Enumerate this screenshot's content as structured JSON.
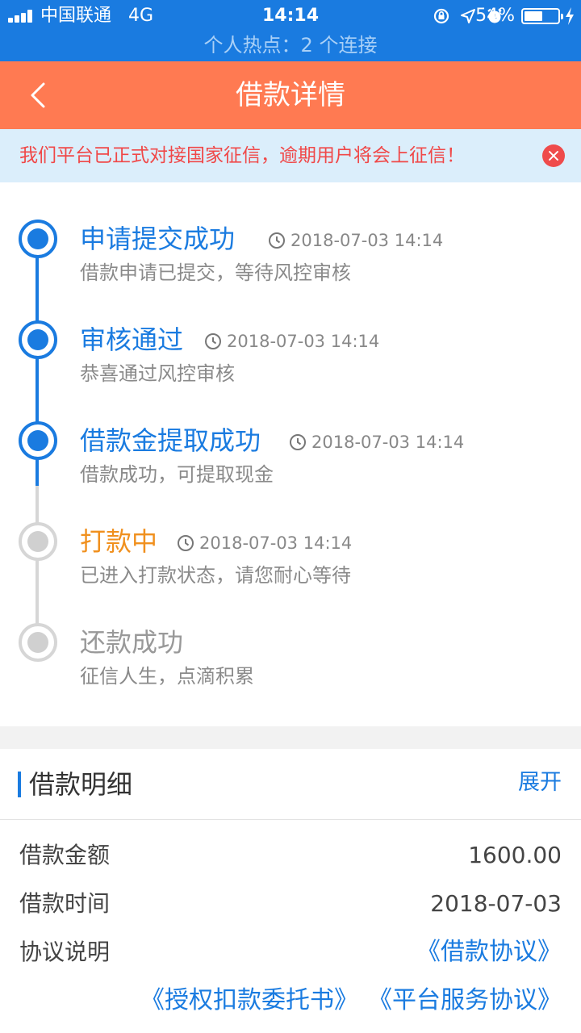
{
  "status_bar": {
    "carrier": "中国联通",
    "network": "4G",
    "time": "14:14",
    "battery": "54%",
    "battery_level": 0.54,
    "hotspot": "个人热点：2 个连接"
  },
  "header": {
    "title": "借款详情",
    "back_icon": "chevron-left-icon"
  },
  "notice": {
    "text": "我们平台已正式对接国家征信，逾期用户将会上征信！"
  },
  "timeline": {
    "steps": [
      {
        "title": "申请提交成功",
        "time": "2018-07-03 14:14",
        "desc": "借款申请已提交，等待风控审核",
        "state": "done"
      },
      {
        "title": "审核通过",
        "time": "2018-07-03 14:14",
        "desc": "恭喜通过风控审核",
        "state": "done"
      },
      {
        "title": "借款金提取成功",
        "time": "2018-07-03 14:14",
        "desc": "借款成功，可提取现金",
        "state": "done"
      },
      {
        "title": "打款中",
        "time": "2018-07-03 14:14",
        "desc": "已进入打款状态，请您耐心等待",
        "state": "current"
      },
      {
        "title": "还款成功",
        "time": "",
        "desc": "征信人生，点滴积累",
        "state": "pending"
      }
    ]
  },
  "details": {
    "title": "借款明细",
    "expand": "展开",
    "rows": [
      {
        "label": "借款金额",
        "value": "1600.00"
      },
      {
        "label": "借款时间",
        "value": "2018-07-03"
      }
    ],
    "agreement_label": "协议说明",
    "links": [
      "《借款协议》",
      "《授权扣款委托书》",
      "《平台服务协议》"
    ]
  },
  "colors": {
    "status_bar": "#1a7be0",
    "header": "#ff7a52",
    "accent_blue": "#1a7be0",
    "accent_orange": "#f0901e",
    "notice_text": "#f04848",
    "pending_gray": "#d0d0d0"
  }
}
